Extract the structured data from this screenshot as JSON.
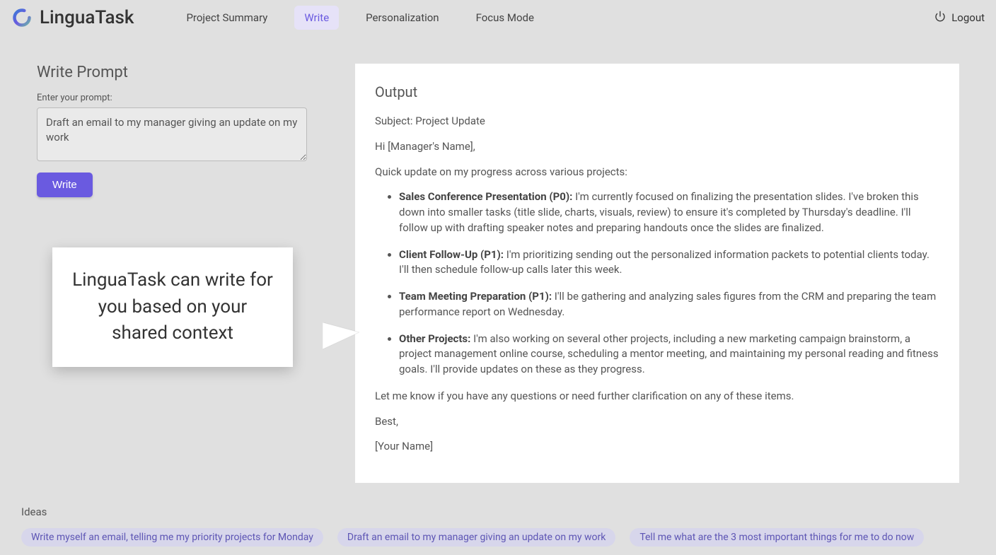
{
  "brand": {
    "name": "LinguaTask"
  },
  "nav": {
    "items": [
      {
        "label": "Project Summary"
      },
      {
        "label": "Write"
      },
      {
        "label": "Personalization"
      },
      {
        "label": "Focus Mode"
      }
    ],
    "logout": "Logout"
  },
  "prompt": {
    "heading": "Write Prompt",
    "label": "Enter your prompt:",
    "value": "Draft an email to my manager giving an update on my work",
    "button": "Write"
  },
  "callout": {
    "text": "LinguaTask can write for you based on your shared context"
  },
  "output": {
    "heading": "Output",
    "subject": "Subject: Project Update",
    "greeting": "Hi [Manager's Name],",
    "intro": "Quick update on my progress across various projects:",
    "items": [
      {
        "title": "Sales Conference Presentation (P0):",
        "body": " I'm currently focused on finalizing the presentation slides. I've broken this down into smaller tasks (title slide, charts, visuals, review) to ensure it's completed by Thursday's deadline. I'll follow up with drafting speaker notes and preparing handouts once the slides are finalized."
      },
      {
        "title": "Client Follow-Up (P1):",
        "body": " I'm prioritizing sending out the personalized information packets to potential clients today. I'll then schedule follow-up calls later this week."
      },
      {
        "title": "Team Meeting Preparation (P1):",
        "body": " I'll be gathering and analyzing sales figures from the CRM and preparing the team performance report on Wednesday."
      },
      {
        "title": "Other Projects:",
        "body": " I'm also working on several other projects, including a new marketing campaign brainstorm, a project management online course, scheduling a mentor meeting, and maintaining my personal reading and fitness goals. I'll provide updates on these as they progress."
      }
    ],
    "closing1": "Let me know if you have any questions or need further clarification on any of these items.",
    "closing2": "Best,",
    "signature": "[Your Name]"
  },
  "ideas": {
    "label": "Ideas",
    "chips": [
      "Write myself an email, telling me my priority projects for Monday",
      "Draft an email to my manager giving an update on my work",
      "Tell me what are the 3 most important things for me to do now"
    ]
  }
}
